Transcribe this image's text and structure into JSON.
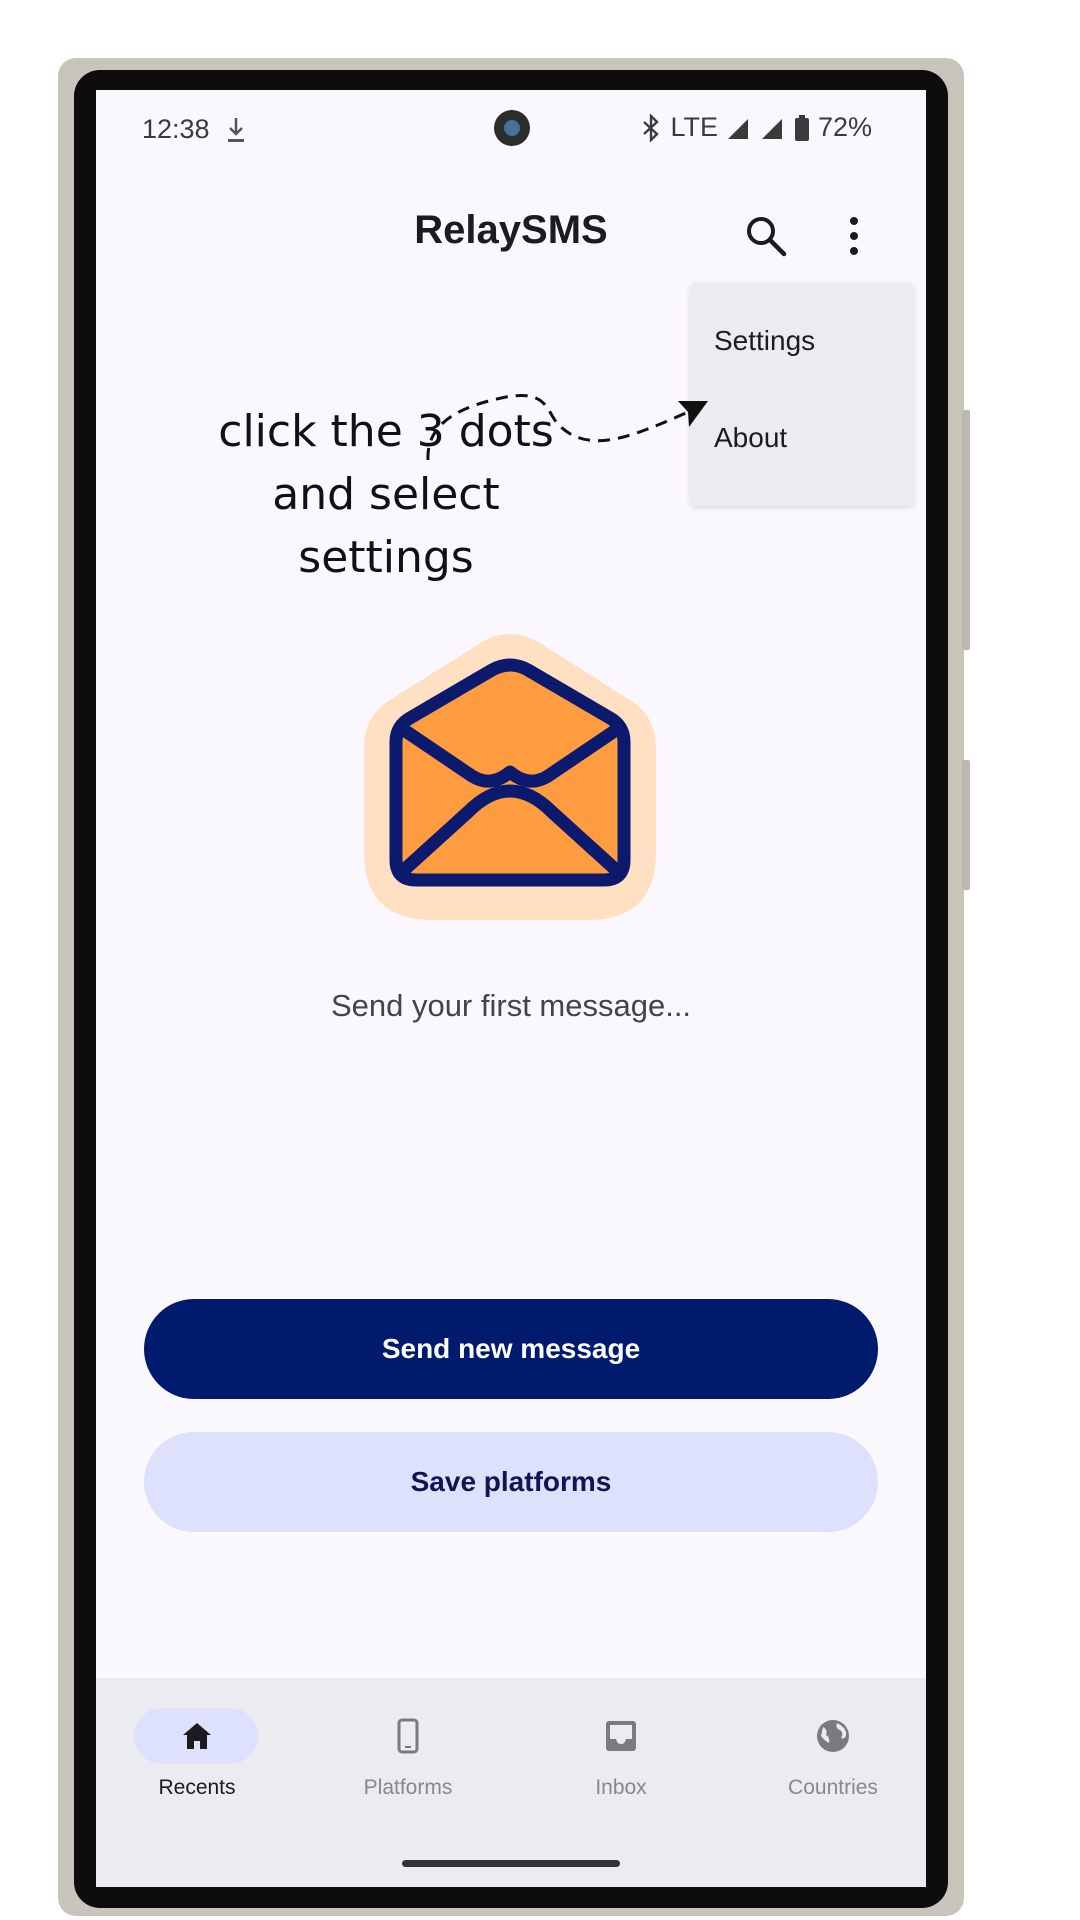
{
  "status_bar": {
    "time": "12:38",
    "network": "LTE",
    "battery": "72%",
    "icons": [
      "download-icon",
      "bluetooth-icon",
      "signal-icon",
      "battery-icon"
    ]
  },
  "app_bar": {
    "title": "RelaySMS",
    "search_icon": "search-icon",
    "more_icon": "more-vert-icon"
  },
  "overflow_menu": {
    "items": [
      {
        "label": "Settings"
      },
      {
        "label": "About"
      }
    ]
  },
  "annotation": {
    "lines": [
      "click the 3 dots",
      "and select",
      "settings"
    ]
  },
  "empty_state": {
    "icon": "open-envelope-icon",
    "message": "Send your first message..."
  },
  "actions": {
    "primary": "Send new message",
    "secondary": "Save platforms"
  },
  "bottom_nav": {
    "items": [
      {
        "label": "Recents",
        "icon": "home-icon",
        "active": true
      },
      {
        "label": "Platforms",
        "icon": "phone-icon",
        "active": false
      },
      {
        "label": "Inbox",
        "icon": "inbox-icon",
        "active": false
      },
      {
        "label": "Countries",
        "icon": "globe-icon",
        "active": false
      }
    ]
  },
  "colors": {
    "primary": "#001a6e",
    "secondary_container": "#dde1fb",
    "background": "#faf7fd",
    "envelope_fill": "#ff9c40",
    "envelope_outline": "#0c1a6e",
    "envelope_halo": "#ffe0c2"
  }
}
